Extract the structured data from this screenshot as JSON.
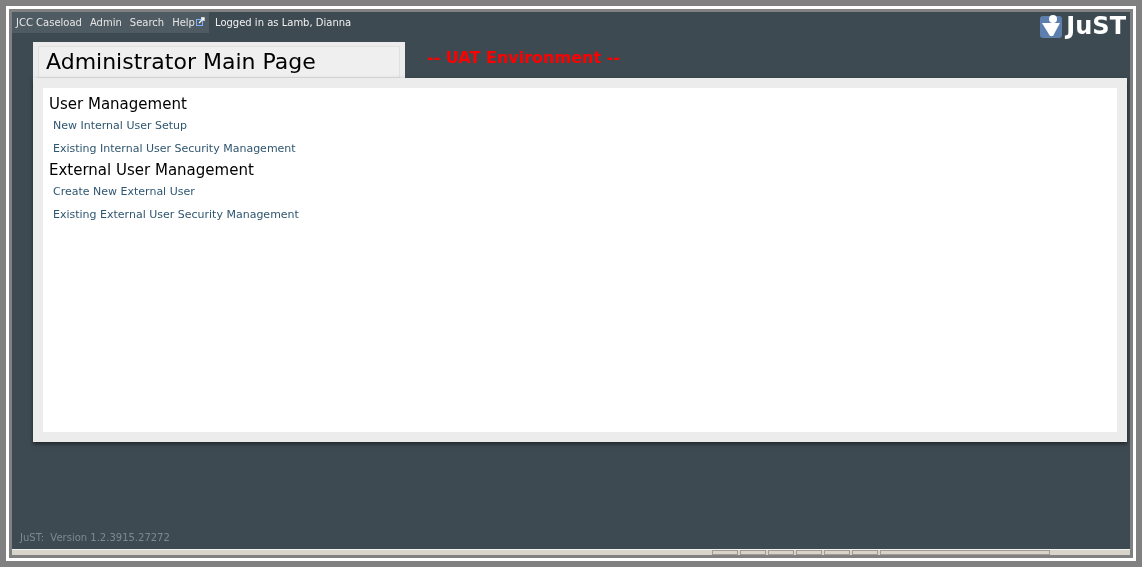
{
  "nav": {
    "items": [
      {
        "label": "JCC Caseload",
        "external": false
      },
      {
        "label": "Admin",
        "external": false
      },
      {
        "label": "Search",
        "external": false
      },
      {
        "label": "Help",
        "external": true
      }
    ],
    "user": "Logged in as Lamb, Dianna"
  },
  "logo": {
    "text": "JuST"
  },
  "page": {
    "title": "Administrator Main Page",
    "environment": "-- UAT Environment --"
  },
  "sections": [
    {
      "heading": "User Management",
      "links": [
        "New Internal User Setup",
        "Existing Internal User Security Management"
      ]
    },
    {
      "heading": "External User Management",
      "links": [
        "Create New External User",
        "Existing External User Security Management"
      ]
    }
  ],
  "footer": {
    "version": "JuST:  Version 1.2.3915.27272"
  }
}
